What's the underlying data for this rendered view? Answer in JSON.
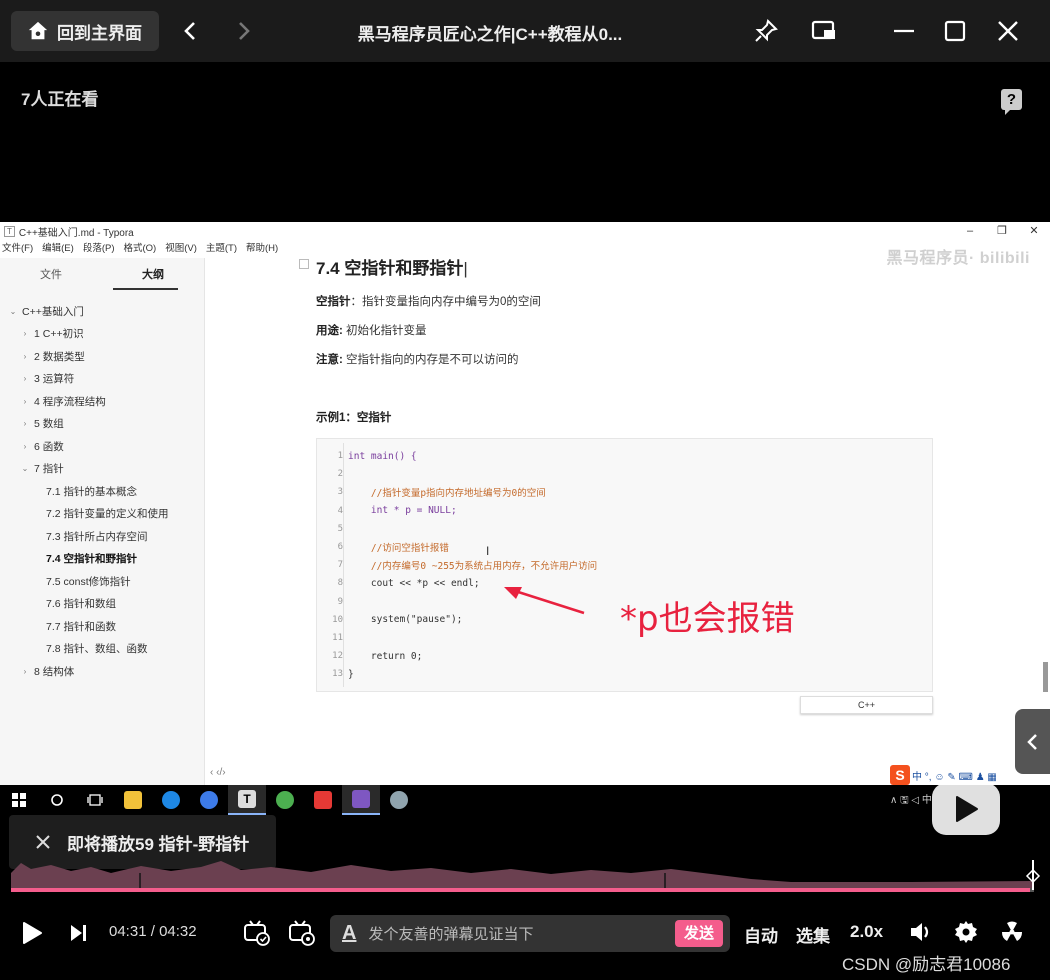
{
  "topbar": {
    "home_label": "回到主界面",
    "title": "黑马程序员匠心之作|C++教程从0..."
  },
  "viewers": "7人正在看",
  "help_icon": "?",
  "typora": {
    "window_title": "C++基础入门.md - Typora",
    "menu": [
      "文件(F)",
      "编辑(E)",
      "段落(P)",
      "格式(O)",
      "视图(V)",
      "主题(T)",
      "帮助(H)"
    ],
    "watermark": "黑马程序员· bilibili",
    "tabs": [
      "文件",
      "大纲"
    ],
    "outline": [
      {
        "label": "C++基础入门",
        "level": 0,
        "toggle": "⌄",
        "bold": false
      },
      {
        "label": "1 C++初识",
        "level": 1,
        "toggle": "›",
        "bold": false
      },
      {
        "label": "2 数据类型",
        "level": 1,
        "toggle": "›",
        "bold": false
      },
      {
        "label": "3 运算符",
        "level": 1,
        "toggle": "›",
        "bold": false
      },
      {
        "label": "4 程序流程结构",
        "level": 1,
        "toggle": "›",
        "bold": false
      },
      {
        "label": "5 数组",
        "level": 1,
        "toggle": "›",
        "bold": false
      },
      {
        "label": "6 函数",
        "level": 1,
        "toggle": "›",
        "bold": false
      },
      {
        "label": "7 指针",
        "level": 1,
        "toggle": "⌄",
        "bold": false
      },
      {
        "label": "7.1 指针的基本概念",
        "level": 2,
        "toggle": "",
        "bold": false
      },
      {
        "label": "7.2 指针变量的定义和使用",
        "level": 2,
        "toggle": "",
        "bold": false
      },
      {
        "label": "7.3 指针所占内存空间",
        "level": 2,
        "toggle": "",
        "bold": false
      },
      {
        "label": "7.4 空指针和野指针",
        "level": 2,
        "toggle": "",
        "bold": true
      },
      {
        "label": "7.5 const修饰指针",
        "level": 2,
        "toggle": "",
        "bold": false
      },
      {
        "label": "7.6 指针和数组",
        "level": 2,
        "toggle": "",
        "bold": false
      },
      {
        "label": "7.7 指针和函数",
        "level": 2,
        "toggle": "",
        "bold": false
      },
      {
        "label": "7.8 指针、数组、函数",
        "level": 2,
        "toggle": "",
        "bold": false
      },
      {
        "label": "8 结构体",
        "level": 1,
        "toggle": "›",
        "bold": false
      }
    ],
    "sidebar_bottom": "‹  ‹/›",
    "doc": {
      "heading": "7.4 空指针和野指针",
      "line1_label": "空指针",
      "line1_text": "：指针变量指向内存中编号为0的空间",
      "line2_label": "用途:",
      "line2_text": " 初始化指针变量",
      "line3_label": "注意:",
      "line3_text": " 空指针指向的内存是不可以访问的",
      "example": "示例1：空指针",
      "code": [
        {
          "n": "1",
          "t": "int main() {",
          "k": "kw"
        },
        {
          "n": "2",
          "t": "",
          "k": ""
        },
        {
          "n": "3",
          "t": "    //指针变量p指向内存地址编号为0的空间",
          "k": "cm"
        },
        {
          "n": "4",
          "t": "    int * p = NULL;",
          "k": "kw"
        },
        {
          "n": "5",
          "t": "",
          "k": ""
        },
        {
          "n": "6",
          "t": "    //访问空指针报错",
          "k": "cm"
        },
        {
          "n": "7",
          "t": "    //内存编号0 ~255为系统占用内存，不允许用户访问",
          "k": "cm"
        },
        {
          "n": "8",
          "t": "    cout << *p << endl;",
          "k": ""
        },
        {
          "n": "9",
          "t": "",
          "k": ""
        },
        {
          "n": "10",
          "t": "    system(\"pause\");",
          "k": ""
        },
        {
          "n": "11",
          "t": "",
          "k": ""
        },
        {
          "n": "12",
          "t": "    return 0;",
          "k": ""
        },
        {
          "n": "13",
          "t": "}",
          "k": ""
        }
      ],
      "lang": "C++",
      "annotation": "*p也会报错"
    },
    "tray_text": "中 °, ☺ ✎ ⌨ ♟ ▦"
  },
  "taskbar_right": "∧ 🖫 ◁ 中",
  "next_up": "即将播放59 指针-野指针",
  "player": {
    "progress_fraction": 0.996,
    "time_current": "04:31",
    "time_sep": " / ",
    "time_total": "04:32",
    "danmaku_placeholder": "发个友善的弹幕见证当下",
    "send_label": "发送",
    "auto_label": "自动",
    "episodes_label": "选集",
    "speed_label": "2.0x"
  },
  "csdn_mark": "CSDN @励志君10086",
  "colors": {
    "accent_pink": "#f45d8c",
    "annotation_red": "#e8223f"
  }
}
